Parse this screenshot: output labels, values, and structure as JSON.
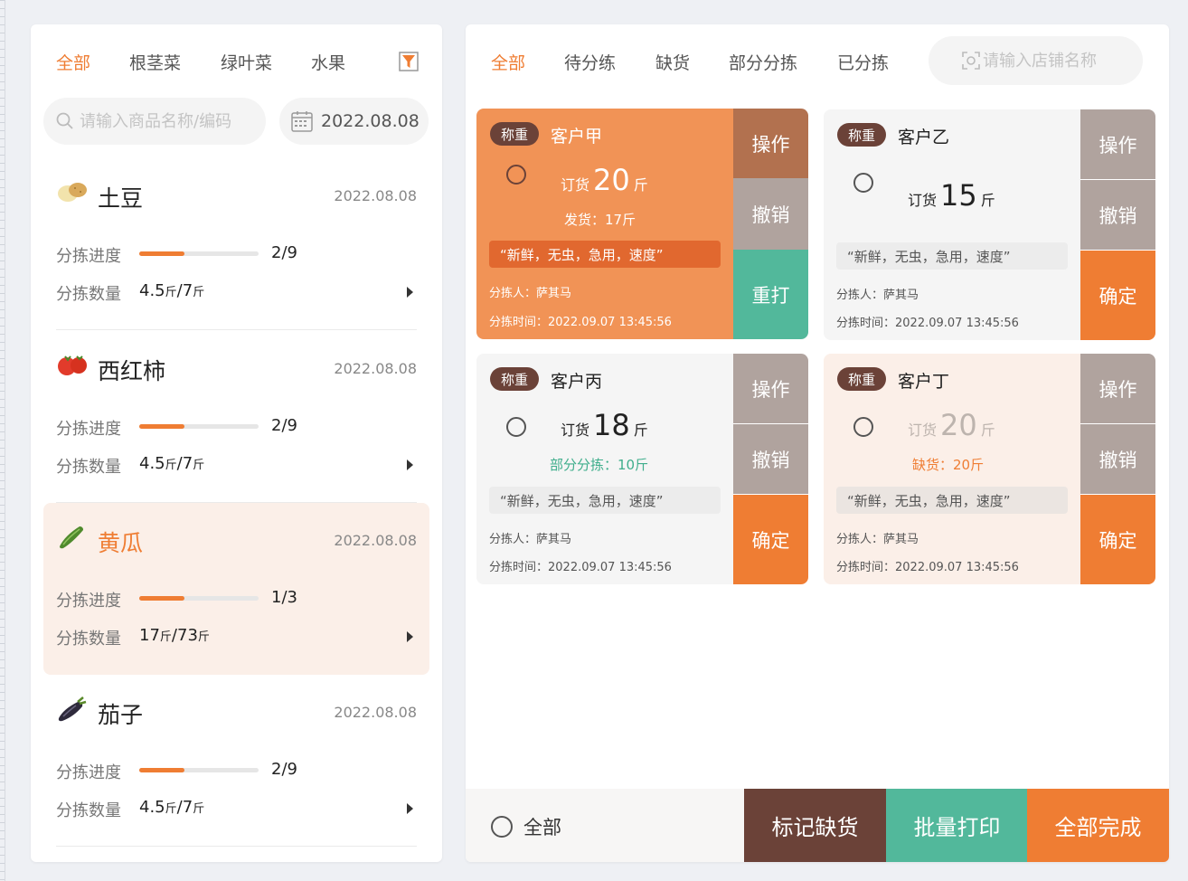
{
  "left": {
    "category_tabs": [
      "全部",
      "根茎菜",
      "绿叶菜",
      "水果"
    ],
    "filter_icon": "filter-icon",
    "search": {
      "placeholder": "请输入商品名称/编码",
      "icon": "search-icon"
    },
    "date": {
      "value": "2022.08.08",
      "icon": "calendar-icon"
    },
    "progress_label": "分拣进度",
    "qty_label": "分拣数量",
    "products": [
      {
        "name": "土豆",
        "icon": "potato-icon",
        "date": "2022.08.08",
        "progress_text": "2/9",
        "progress_fill": 0.38,
        "qty_done": "4.5",
        "qty_total": "7",
        "unit": "斤"
      },
      {
        "name": "西红柿",
        "icon": "tomato-icon",
        "date": "2022.08.08",
        "progress_text": "2/9",
        "progress_fill": 0.38,
        "qty_done": "4.5",
        "qty_total": "7",
        "unit": "斤"
      },
      {
        "name": "黄瓜",
        "icon": "cucumber-icon",
        "date": "2022.08.08",
        "progress_text": "1/3",
        "progress_fill": 0.38,
        "qty_done": "17",
        "qty_total": "73",
        "unit": "斤"
      },
      {
        "name": "茄子",
        "icon": "eggplant-icon",
        "date": "2022.08.08",
        "progress_text": "2/9",
        "progress_fill": 0.38,
        "qty_done": "4.5",
        "qty_total": "7",
        "unit": "斤"
      }
    ]
  },
  "right": {
    "status_tabs": [
      "全部",
      "待分练",
      "缺货",
      "部分分拣",
      "已分拣"
    ],
    "shop_search": {
      "placeholder": "请输入店铺名称",
      "icon": "scan-icon"
    },
    "orders": [
      {
        "badge": "称重",
        "customer": "客户甲",
        "order_label": "订货",
        "order_qty": "20",
        "unit": "斤",
        "sub": "发货：17斤",
        "note": "“新鲜，无虫，急用，速度”",
        "sorter": "分拣人：萨其马",
        "time": "分拣时间：2022.09.07 13:45:56",
        "buttons": [
          "操作",
          "撤销",
          "重打"
        ]
      },
      {
        "badge": "称重",
        "customer": "客户乙",
        "order_label": "订货",
        "order_qty": "15",
        "unit": "斤",
        "sub": "",
        "note": "“新鲜，无虫，急用，速度”",
        "sorter": "分拣人：萨其马",
        "time": "分拣时间：2022.09.07 13:45:56",
        "buttons": [
          "操作",
          "撤销",
          "确定"
        ]
      },
      {
        "badge": "称重",
        "customer": "客户丙",
        "order_label": "订货",
        "order_qty": "18",
        "unit": "斤",
        "sub": "部分分拣：10斤",
        "note": "“新鲜，无虫，急用，速度”",
        "sorter": "分拣人：萨其马",
        "time": "分拣时间：2022.09.07 13:45:56",
        "buttons": [
          "操作",
          "撤销",
          "确定"
        ]
      },
      {
        "badge": "称重",
        "customer": "客户丁",
        "order_label": "订货",
        "order_qty": "20",
        "unit": "斤",
        "sub": "缺货：20斤",
        "note": "“新鲜，无虫，急用，速度”",
        "sorter": "分拣人：萨其马",
        "time": "分拣时间：2022.09.07 13:45:56",
        "buttons": [
          "操作",
          "撤销",
          "确定"
        ]
      }
    ],
    "bottom": {
      "select_all": "全部",
      "mark_short": "标记缺货",
      "batch_print": "批量打印",
      "complete_all": "全部完成"
    }
  },
  "colors": {
    "accent": "#ef7d33",
    "brown": "#6b4238",
    "teal": "#52b89b",
    "grey_btn": "#b0a39e",
    "light_peach": "#fbefe8"
  }
}
